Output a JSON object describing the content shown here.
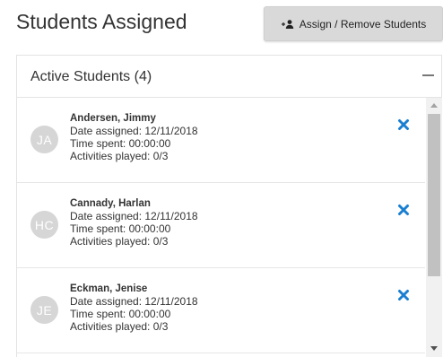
{
  "header": {
    "title": "Students Assigned",
    "assign_button_label": "Assign / Remove Students"
  },
  "panel": {
    "title": "Active Students (4)"
  },
  "students": [
    {
      "initials": "JA",
      "name": "Andersen, Jimmy",
      "date_assigned": "Date assigned: 12/11/2018",
      "time_spent": "Time spent: 00:00:00",
      "activities": "Activities played: 0/3"
    },
    {
      "initials": "HC",
      "name": "Cannady, Harlan",
      "date_assigned": "Date assigned: 12/11/2018",
      "time_spent": "Time spent: 00:00:00",
      "activities": "Activities played: 0/3"
    },
    {
      "initials": "JE",
      "name": "Eckman, Jenise",
      "date_assigned": "Date assigned: 12/11/2018",
      "time_spent": "Time spent: 00:00:00",
      "activities": "Activities played: 0/3"
    }
  ],
  "icons": {
    "assign": "add-user-icon",
    "remove": "close-icon",
    "collapse": "minus-icon"
  },
  "colors": {
    "remove_icon": "#1a7fd1",
    "avatar_bg": "#d6d6d6",
    "button_bg": "#d9d9d9"
  }
}
